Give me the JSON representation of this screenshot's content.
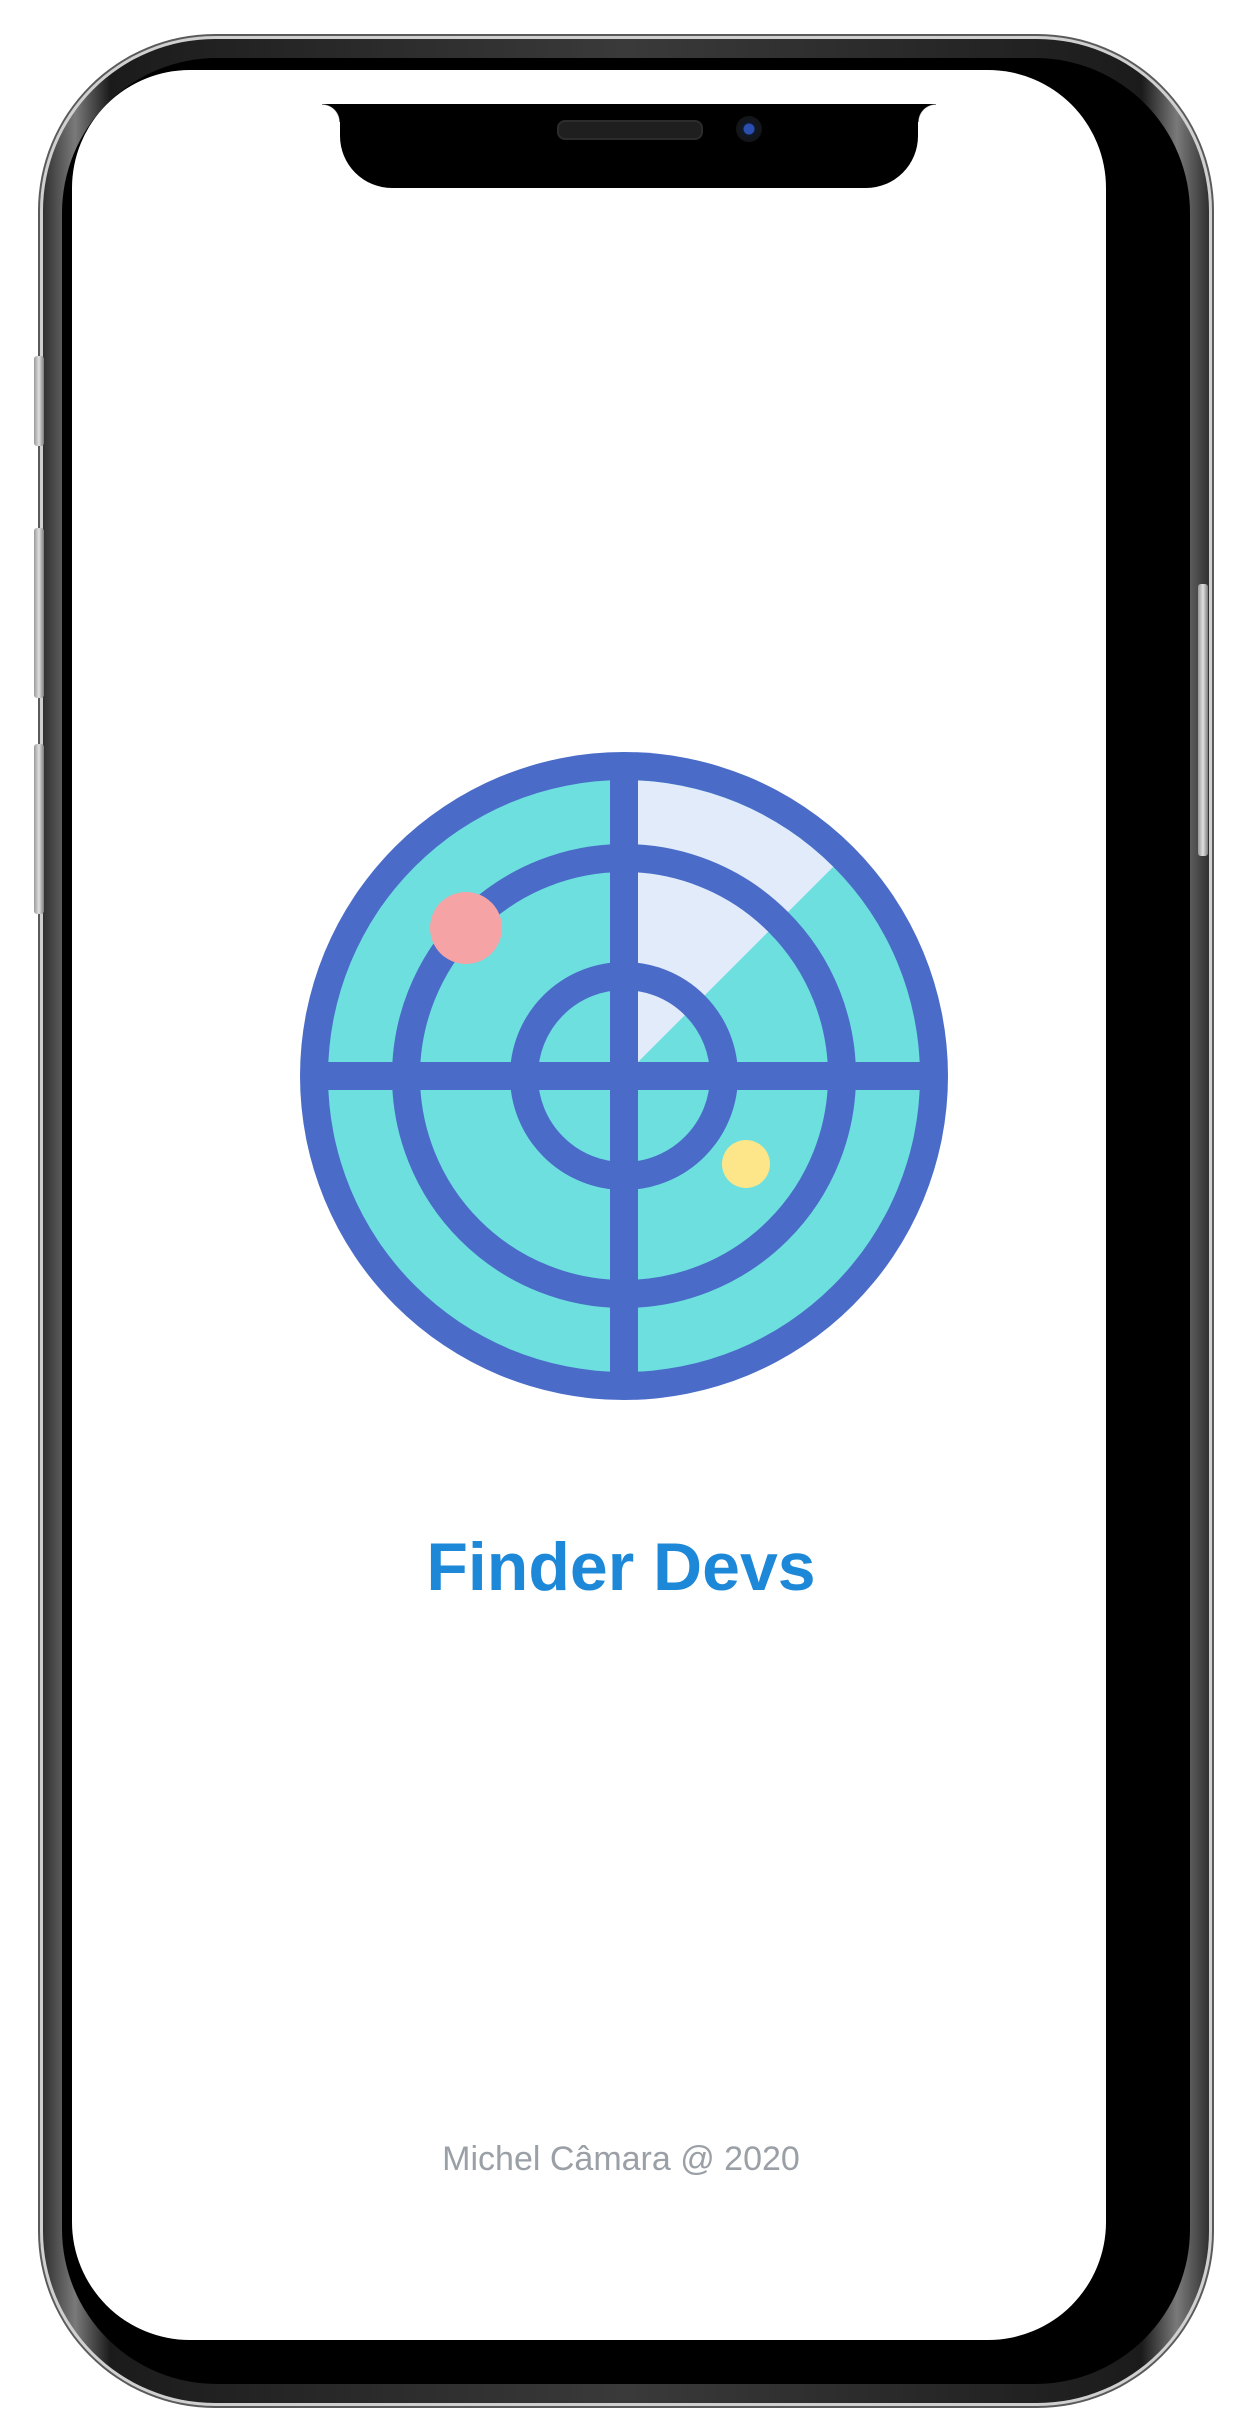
{
  "app": {
    "title": "Finder Devs",
    "footer": "Michel Câmara @ 2020"
  },
  "logo": {
    "icon": "radar-icon",
    "colors": {
      "ring": "#4a6cc8",
      "fill": "#6ddfdf",
      "sweep": "#e1ebf9",
      "blip_red": "#f6a3a6",
      "blip_yellow": "#fde68a"
    }
  },
  "theme": {
    "title_color": "#1e88d8",
    "footer_color": "#9aa0a6",
    "background": "#ffffff"
  }
}
